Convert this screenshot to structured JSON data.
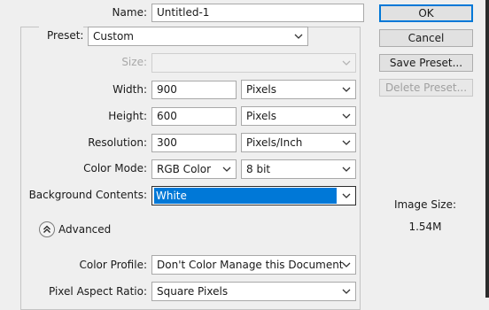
{
  "labels": {
    "name": "Name:",
    "preset": "Preset:",
    "size": "Size:",
    "width": "Width:",
    "height": "Height:",
    "resolution": "Resolution:",
    "color_mode": "Color Mode:",
    "background_contents": "Background Contents:",
    "advanced": "Advanced",
    "color_profile": "Color Profile:",
    "pixel_aspect_ratio": "Pixel Aspect Ratio:"
  },
  "values": {
    "name": "Untitled-1",
    "preset": "Custom",
    "size": "",
    "width": "900",
    "width_unit": "Pixels",
    "height": "600",
    "height_unit": "Pixels",
    "resolution": "300",
    "resolution_unit": "Pixels/Inch",
    "color_mode": "RGB Color",
    "bit_depth": "8 bit",
    "background_contents": "White",
    "color_profile": "Don't Color Manage this Document",
    "pixel_aspect_ratio": "Square Pixels"
  },
  "buttons": {
    "ok": "OK",
    "cancel": "Cancel",
    "save_preset": "Save Preset...",
    "delete_preset": "Delete Preset..."
  },
  "info": {
    "image_size_label": "Image Size:",
    "image_size_value": "1.54M"
  },
  "icons": {
    "dropdown": "chevron-down-icon",
    "advanced_toggle": "chevron-up-double-icon"
  }
}
